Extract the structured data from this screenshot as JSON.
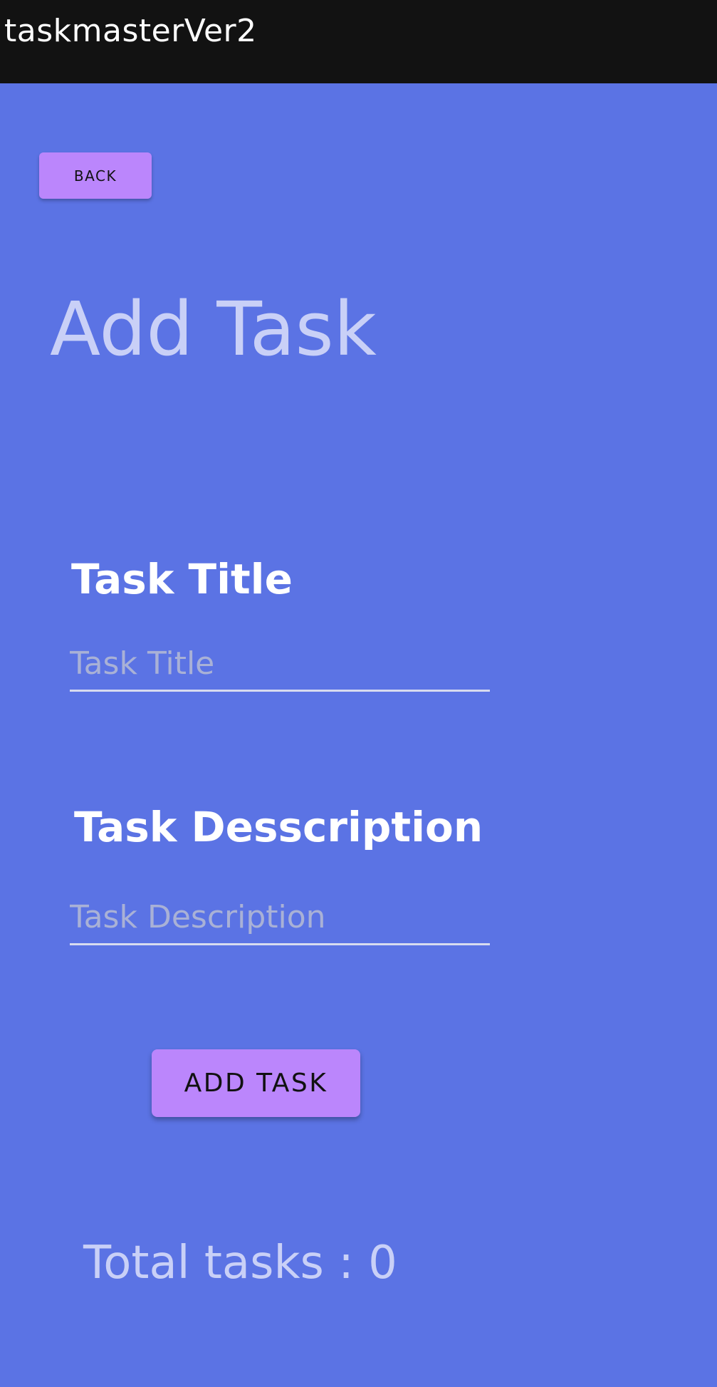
{
  "app_bar": {
    "title": "taskmasterVer2"
  },
  "main": {
    "back_button": "BACK",
    "heading": "Add Task",
    "task_title_label": "Task Title",
    "task_title_input": {
      "value": "",
      "placeholder": "Task Title"
    },
    "task_description_label": "Task Desscription",
    "task_description_input": {
      "value": "",
      "placeholder": "Task Description"
    },
    "add_button": "ADD TASK",
    "total_tasks": "Total tasks : 0"
  },
  "colors": {
    "app_bar": "#121212",
    "background": "#5b73e4",
    "button": "#bb86fc",
    "heading_text": "#c9d0f7",
    "label_text": "#ffffff"
  }
}
